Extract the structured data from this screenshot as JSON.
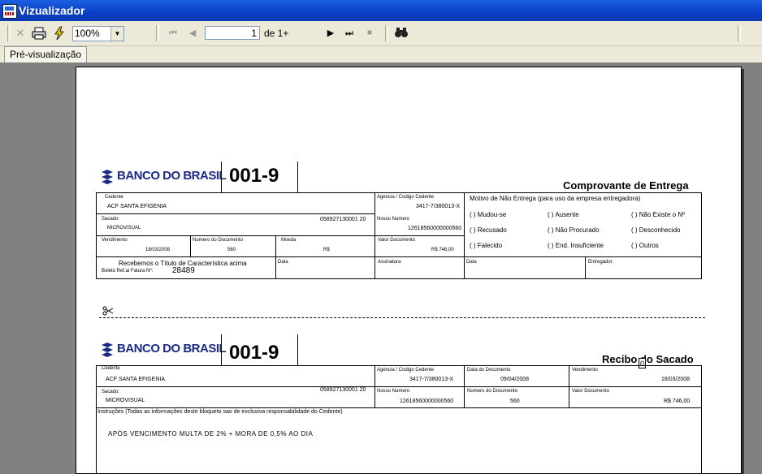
{
  "window": {
    "title": "Vizualizador",
    "icon": "app-logo-icon"
  },
  "toolbar": {
    "close_icon": "close-icon",
    "print_icon": "printer-icon",
    "lightning_icon": "lightning-icon",
    "zoom_value": "100%",
    "page_value": "1",
    "page_of": "de 1+",
    "find_icon": "binoculars-icon"
  },
  "tabs": [
    {
      "label": "Pré-visualização"
    }
  ],
  "document": {
    "bank_name": "BANCO DO BRASIL",
    "bank_code": "001-9",
    "delivery": {
      "title": "Comprovante de Entrega",
      "cedente_label": "Cedente",
      "cedente_value": "ACF SANTA EFIGENIA",
      "agencia_label": "Agencia / Codigo Cedente",
      "agencia_value": "3417-7/380013-X",
      "sacado_label": "Sacado:",
      "sacado_value": "MICROVISUAL",
      "sacado_doc": "058927130001 20",
      "nosso_label": "Nosso Numero",
      "nosso_value": "12618560000000560",
      "venc_label": "Vendimento",
      "venc_value": "18/03/2008",
      "numdoc_label": "Numero do Documento",
      "numdoc_value": "560",
      "moeda_label": "Moeda",
      "moeda_value": "R$",
      "valor_label": "Valor Documento",
      "valor_value": "R$ 746,00",
      "recebemos": "Recebemos o Título de Característica acima",
      "boleto_label": "Boleto Ref.ai Fatura Nº:",
      "boleto_value": "28489",
      "data_label": "Data",
      "assinatura_label": "Assinatura",
      "data2_label": "Data",
      "entregador_label": "Entregador",
      "motivo_label": "Motivo de Não Entrega (para uso da empresa entregadora)",
      "motivos": [
        "( ) Mudou-se",
        "( ) Ausente",
        "( ) Não Existe o Nº",
        "( ) Recusado",
        "( ) Não Procurado",
        "( ) Desconhecido",
        "( ) Falecido",
        "( ) End. Insuficiente",
        "( ) Outros"
      ]
    },
    "receipt": {
      "title": "Recibo do Sacado",
      "cursor_char": "0",
      "cedente_label": "Cedente",
      "cedente_value": "ACF SANTA EFIGENIA",
      "agencia_label": "Agencia / Codigo Cedente",
      "agencia_value": "3417-7/380013-X",
      "datadoc_label": "Data do Documento",
      "datadoc_value": "09/04/2008",
      "venc_label": "Vendimento",
      "venc_value": "18/03/2008",
      "sacado_label": "Sacado:",
      "sacado_value": "MICROVISUAL",
      "sacado_doc": "058927130001 20",
      "nosso_label": "Nosso Numero",
      "nosso_value": "12618560000000560",
      "numdoc_label": "Numero do Documento",
      "numdoc_value": "560",
      "valor_label": "Valor Documento",
      "valor_value": "R$ 746,00",
      "instrucoes": "Instruções (Todas as informações deste bloqueto sao de exclusiva responsabilidade do Cedente)",
      "multa": "APÓS VENCIMENTO MULTA DE 2% + MORA DE 0,5% AO DIA"
    },
    "scissors_icon": "scissors-icon"
  }
}
